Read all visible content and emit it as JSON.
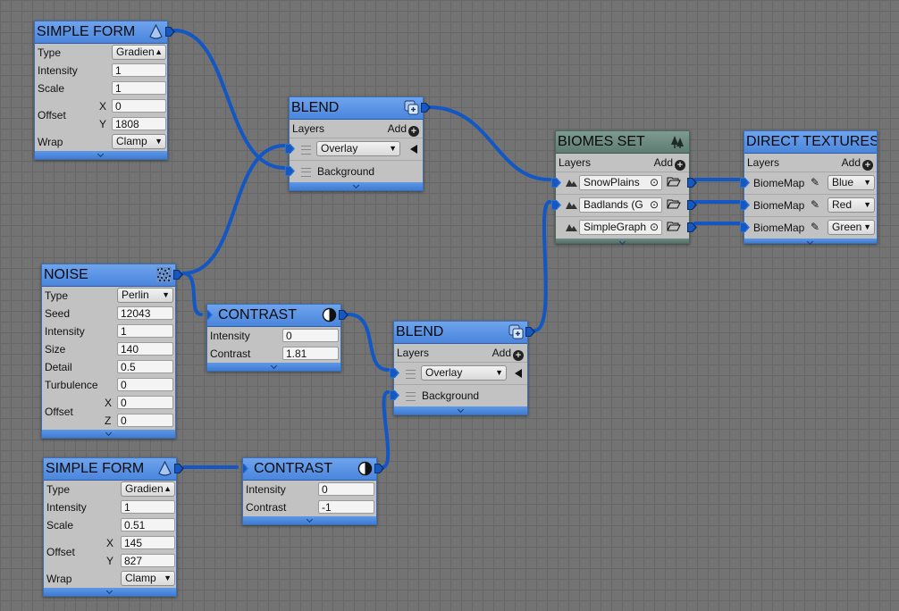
{
  "nodes": {
    "simple_form_1": {
      "title": "SIMPLE FORM",
      "rows": [
        {
          "label": "Type",
          "value": "Gradien"
        },
        {
          "label": "Intensity",
          "value": "1"
        },
        {
          "label": "Scale",
          "value": "1"
        },
        {
          "label": "Offset",
          "sub_x": "X",
          "x": "0",
          "sub_y": "Y",
          "y": "1808"
        },
        {
          "label": "Wrap",
          "value": "Clamp"
        }
      ]
    },
    "blend_1": {
      "title": "BLEND",
      "layers_label": "Layers",
      "add_label": "Add",
      "mode": "Overlay",
      "background_label": "Background"
    },
    "biomes_set": {
      "title": "BIOMES SET",
      "layers_label": "Layers",
      "add_label": "Add",
      "items": [
        "SnowPlains",
        "Badlands (G",
        "SimpleGraph"
      ]
    },
    "direct_textures": {
      "title": "DIRECT TEXTURES",
      "layers_label": "Layers",
      "add_label": "Add",
      "items": [
        {
          "label": "BiomeMap",
          "channel": "Blue"
        },
        {
          "label": "BiomeMap",
          "channel": "Red"
        },
        {
          "label": "BiomeMap",
          "channel": "Green"
        }
      ]
    },
    "noise": {
      "title": "NOISE",
      "rows": [
        {
          "label": "Type",
          "value": "Perlin"
        },
        {
          "label": "Seed",
          "value": "12043"
        },
        {
          "label": "Intensity",
          "value": "1"
        },
        {
          "label": "Size",
          "value": "140"
        },
        {
          "label": "Detail",
          "value": "0.5"
        },
        {
          "label": "Turbulence",
          "value": "0"
        },
        {
          "label": "Offset",
          "sub_x": "X",
          "x": "0",
          "sub_z": "Z",
          "z": "0"
        }
      ]
    },
    "contrast_1": {
      "title": "CONTRAST",
      "rows": [
        {
          "label": "Intensity",
          "value": "0"
        },
        {
          "label": "Contrast",
          "value": "1.81"
        }
      ]
    },
    "blend_2": {
      "title": "BLEND",
      "layers_label": "Layers",
      "add_label": "Add",
      "mode": "Overlay",
      "background_label": "Background"
    },
    "simple_form_2": {
      "title": "SIMPLE FORM",
      "rows": [
        {
          "label": "Type",
          "value": "Gradien"
        },
        {
          "label": "Intensity",
          "value": "1"
        },
        {
          "label": "Scale",
          "value": "0.51"
        },
        {
          "label": "Offset",
          "sub_x": "X",
          "x": "145",
          "sub_y": "Y",
          "y": "827"
        },
        {
          "label": "Wrap",
          "value": "Clamp"
        }
      ]
    },
    "contrast_2": {
      "title": "CONTRAST",
      "rows": [
        {
          "label": "Intensity",
          "value": "0"
        },
        {
          "label": "Contrast",
          "value": "-1"
        }
      ]
    }
  },
  "colors": {
    "wire": "#1257c4",
    "header": "#5a93e4",
    "biomes_header": "#6b8980",
    "canvas": "#737373"
  },
  "icons": {
    "simple_form": "cone-icon",
    "blend": "blend-layers-icon",
    "biomes_set": "trees-icon",
    "noise": "noise-texture-icon",
    "contrast": "contrast-icon",
    "biome_item": "landscape-icon",
    "folder": "folder-open-icon",
    "target": "target-icon",
    "pencil": "pencil-icon"
  }
}
